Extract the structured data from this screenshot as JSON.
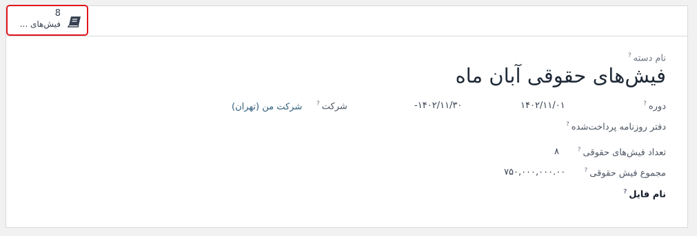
{
  "smart_button": {
    "count": "8",
    "label": "فیش‌های ...",
    "icon": "book-icon"
  },
  "form": {
    "batch_name_label": "نام دسته",
    "batch_name": "فیش‌های حقوقی آبان ماه",
    "period_label": "دوره",
    "period_start": "۱۴۰۲/۱۱/۰۱",
    "period_end": "۱۴۰۲/۱۱/۳۰",
    "period_separator": "-",
    "company_label": "شرکت",
    "company_value": "شرکت من (تهران)",
    "journal_label": "دفتر روزنامه پرداخت‌شده",
    "payslip_count_label": "تعداد فیش‌های حقوقی",
    "payslip_count": "۸",
    "payslip_total_label": "مجموع فیش حقوقی",
    "payslip_total": "۷۵۰,۰۰۰,۰۰۰.۰۰",
    "file_name_label": "نام فایل",
    "help_mark": "?"
  },
  "colors": {
    "highlight_border": "#e0141b",
    "link": "#2f5d7c"
  }
}
